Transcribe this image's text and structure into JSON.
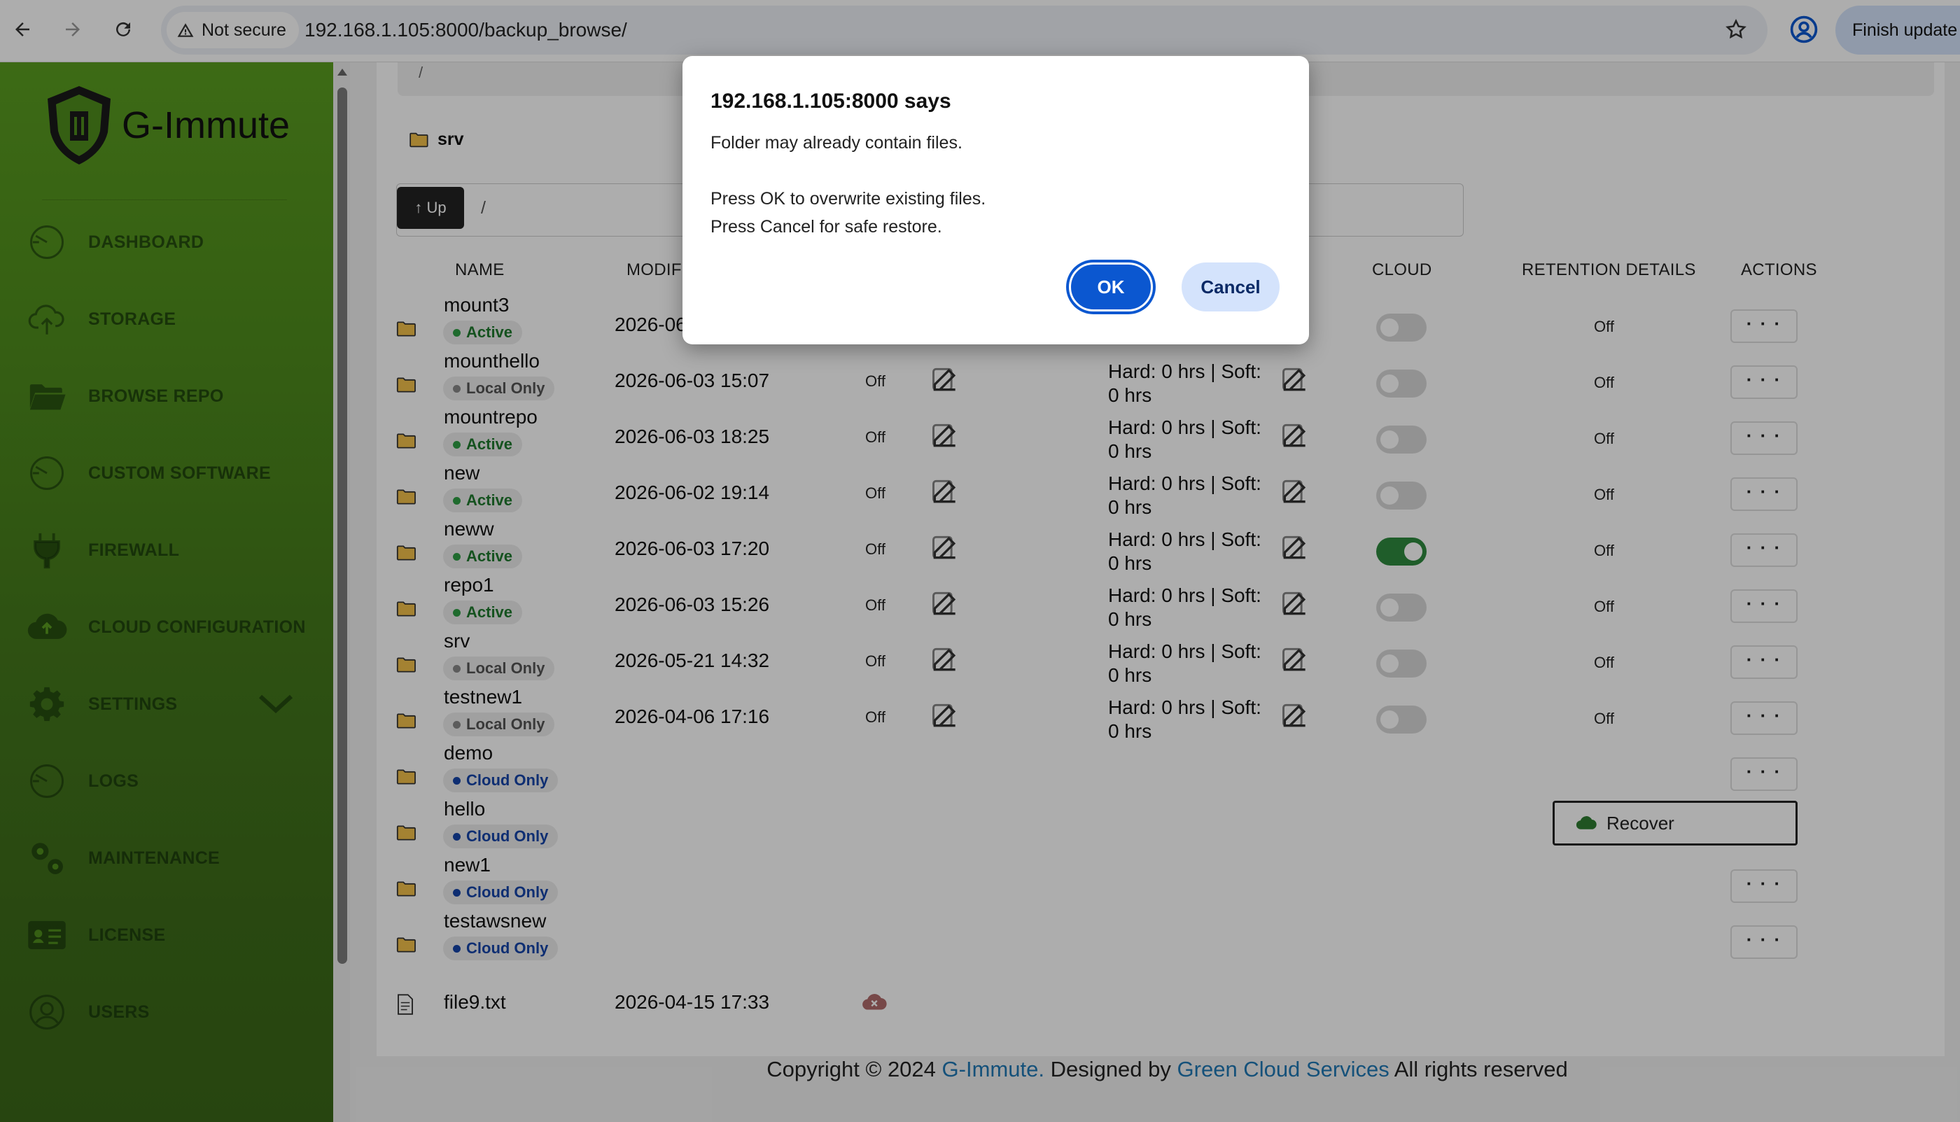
{
  "browser": {
    "security_label": "Not secure",
    "url": "192.168.1.105:8000/backup_browse/",
    "finish_update_label": "Finish update"
  },
  "app": {
    "logo_text": "G-Immute",
    "top_path_fragment": "/"
  },
  "sidebar": {
    "items": [
      {
        "label": "DASHBOARD",
        "icon": "gauge-icon"
      },
      {
        "label": "STORAGE",
        "icon": "cloud-upload-icon"
      },
      {
        "label": "BROWSE REPO",
        "icon": "folder-open-icon"
      },
      {
        "label": "CUSTOM SOFTWARE",
        "icon": "gauge-icon"
      },
      {
        "label": "FIREWALL",
        "icon": "plug-icon"
      },
      {
        "label": "CLOUD CONFIGURATION",
        "icon": "cloud-icon"
      },
      {
        "label": "SETTINGS",
        "icon": "gear-icon"
      },
      {
        "label": "LOGS",
        "icon": "gauge-icon"
      },
      {
        "label": "MAINTENANCE",
        "icon": "gears-icon"
      },
      {
        "label": "LICENSE",
        "icon": "id-card-icon"
      },
      {
        "label": "USERS",
        "icon": "user-icon"
      }
    ]
  },
  "browser_panel": {
    "current_folder": "srv",
    "up_label": "↑ Up",
    "path_value": "/",
    "columns": {
      "name": "NAME",
      "modified": "MODIF",
      "cloud": "CLOUD",
      "retention": "RETENTION DETAILS",
      "actions": "ACTIONS"
    },
    "rows": [
      {
        "name": "mount3",
        "status": "Active",
        "modified": "2026-06",
        "off1": "",
        "retention": "",
        "off2": "Off"
      },
      {
        "name": "mounthello",
        "status": "Local Only",
        "modified": "2026-06-03 15:07",
        "off1": "Off",
        "retention": "Hard: 0 hrs | Soft: 0 hrs",
        "off2": "Off"
      },
      {
        "name": "mountrepo",
        "status": "Active",
        "modified": "2026-06-03 18:25",
        "off1": "Off",
        "retention": "Hard: 0 hrs | Soft: 0 hrs",
        "off2": "Off"
      },
      {
        "name": "new",
        "status": "Active",
        "modified": "2026-06-02 19:14",
        "off1": "Off",
        "retention": "Hard: 0 hrs | Soft: 0 hrs",
        "off2": "Off"
      },
      {
        "name": "neww",
        "status": "Active",
        "modified": "2026-06-03 17:20",
        "off1": "Off",
        "retention": "Hard: 0 hrs | Soft: 0 hrs",
        "off2": "Off"
      },
      {
        "name": "repo1",
        "status": "Active",
        "modified": "2026-06-03 15:26",
        "off1": "Off",
        "retention": "Hard: 0 hrs | Soft: 0 hrs",
        "off2": "Off"
      },
      {
        "name": "srv",
        "status": "Local Only",
        "modified": "2026-05-21 14:32",
        "off1": "Off",
        "retention": "Hard: 0 hrs | Soft: 0 hrs",
        "off2": "Off"
      },
      {
        "name": "testnew1",
        "status": "Local Only",
        "modified": "2026-04-06 17:16",
        "off1": "Off",
        "retention": "Hard: 0 hrs | Soft: 0 hrs",
        "off2": "Off"
      },
      {
        "name": "demo",
        "status": "Cloud Only"
      },
      {
        "name": "hello",
        "status": "Cloud Only"
      },
      {
        "name": "new1",
        "status": "Cloud Only"
      },
      {
        "name": "testawsnew",
        "status": "Cloud Only"
      },
      {
        "name": "file9.txt",
        "modified": "2026-04-15 17:33"
      }
    ],
    "retention_line1": "Hard: 0 hrs | Soft:",
    "retention_line2": "0 hrs",
    "actions_label": "· · ·",
    "recover_label": "Recover"
  },
  "footer": {
    "prefix": "Copyright © 2024",
    "brand": "G-Immute.",
    "designed_by": "Designed by",
    "company": "Green Cloud Services",
    "suffix": "All rights reserved"
  },
  "dialog": {
    "title": "192.168.1.105:8000 says",
    "line1": "Folder may already contain files.",
    "line2": "Press OK to overwrite existing files.",
    "line3": "Press Cancel for safe restore.",
    "ok_label": "OK",
    "cancel_label": "Cancel"
  },
  "colors": {
    "sidebar_green": "#4f8d1c",
    "active_badge": "#1f7a2e",
    "cloud_badge": "#1644a8",
    "dialog_primary": "#0b57d0",
    "link": "#1f78b4"
  }
}
